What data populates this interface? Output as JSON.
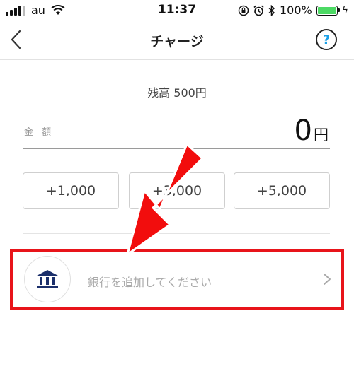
{
  "status_bar": {
    "carrier": "au",
    "time": "11:37",
    "battery_percent": "100%",
    "battery_level": 1.0,
    "signal_bars_filled": 4,
    "icons": [
      "wifi-icon",
      "rotation-lock-icon",
      "alarm-icon",
      "bluetooth-icon",
      "battery-icon",
      "charging-icon"
    ]
  },
  "nav": {
    "title": "チャージ",
    "back_icon": "chevron-left-icon",
    "help_label": "?"
  },
  "balance": {
    "text": "残高  500円"
  },
  "amount": {
    "label": "金 額",
    "value": "0",
    "unit": "円"
  },
  "presets": [
    {
      "label": "+1,000"
    },
    {
      "label": "+3,000"
    },
    {
      "label": "+5,000"
    }
  ],
  "bank": {
    "icon": "bank-icon",
    "label": "銀行を追加してください"
  },
  "colors": {
    "highlight_red": "#e8141a",
    "help_blue": "#1aa0e8",
    "bank_icon_navy": "#1b2f6b",
    "battery_green": "#4cd964"
  }
}
